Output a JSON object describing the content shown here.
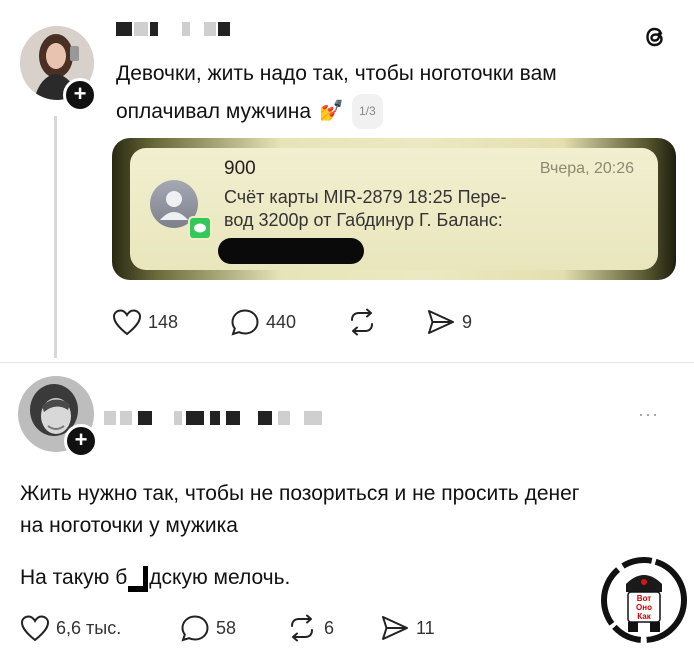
{
  "post1": {
    "text_line1": "Девочки, жить надо так, чтобы ноготочки вам",
    "text_line2": "оплачивал мужчина",
    "emoji": "💅",
    "image_counter": "1/3",
    "sms": {
      "sender": "900",
      "time": "Вчера, 20:26",
      "body_line1": "Счёт карты MIR-2879 18:25 Пере-",
      "body_line2": "вод 3200р от Габдинур Г. Баланс:"
    },
    "stats": {
      "likes": "148",
      "comments": "440",
      "reposts": "",
      "shares": "9"
    }
  },
  "post2": {
    "text_line1": "Жить нужно так, чтобы не позориться и не просить денег",
    "text_line2": "на ноготочки у мужика",
    "text_line3_pre": "На такую б",
    "text_line3_post": "дскую мелочь.",
    "more": "···",
    "stats": {
      "likes": "6,6 тыс.",
      "comments": "58",
      "reposts": "6",
      "shares": "11"
    }
  },
  "watermark": {
    "line1": "Вот",
    "line2": "Оно",
    "line3": "Как"
  },
  "colors": {
    "text": "#111111",
    "muted": "#333333",
    "card_bg": "#ece9c2",
    "imessage_green": "#34c759"
  },
  "icons": [
    "threads-logo-icon",
    "heart-icon",
    "comment-icon",
    "repost-icon",
    "share-icon",
    "more-icon",
    "avatar-placeholder-icon"
  ]
}
